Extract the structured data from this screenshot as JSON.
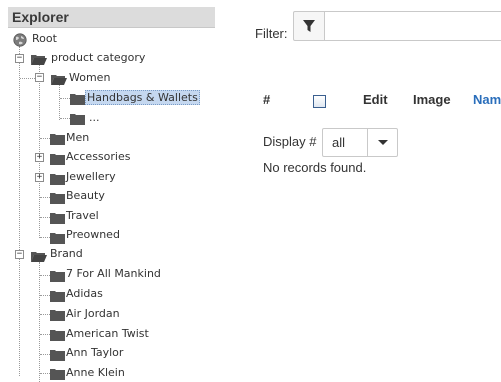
{
  "explorer": {
    "title": "Explorer",
    "root_label": "Root",
    "nodes": [
      {
        "label": "product category"
      },
      {
        "label": "Women"
      },
      {
        "label": "Handbags & Wallets"
      },
      {
        "label": "..."
      },
      {
        "label": "Men"
      },
      {
        "label": "Accessories"
      },
      {
        "label": "Jewellery"
      },
      {
        "label": "Beauty"
      },
      {
        "label": "Travel"
      },
      {
        "label": "Preowned"
      },
      {
        "label": "Brand"
      },
      {
        "label": "7 For All Mankind"
      },
      {
        "label": "Adidas"
      },
      {
        "label": "Air Jordan"
      },
      {
        "label": "American Twist"
      },
      {
        "label": "Ann Taylor"
      },
      {
        "label": "Anne Klein"
      }
    ],
    "toggle_expanded": "−",
    "toggle_collapsed": "+"
  },
  "filter": {
    "label": "Filter:",
    "input_value": "",
    "icon": "filter-icon"
  },
  "table": {
    "headers": {
      "index": "#",
      "edit": "Edit",
      "image": "Image",
      "name": "Nam"
    },
    "display_label": "Display #",
    "display_value": "all",
    "empty_message": "No records found."
  },
  "colors": {
    "header_bg": "#dcdcdc",
    "selected_bg": "#c5d8f0",
    "link": "#2a6ebb"
  }
}
